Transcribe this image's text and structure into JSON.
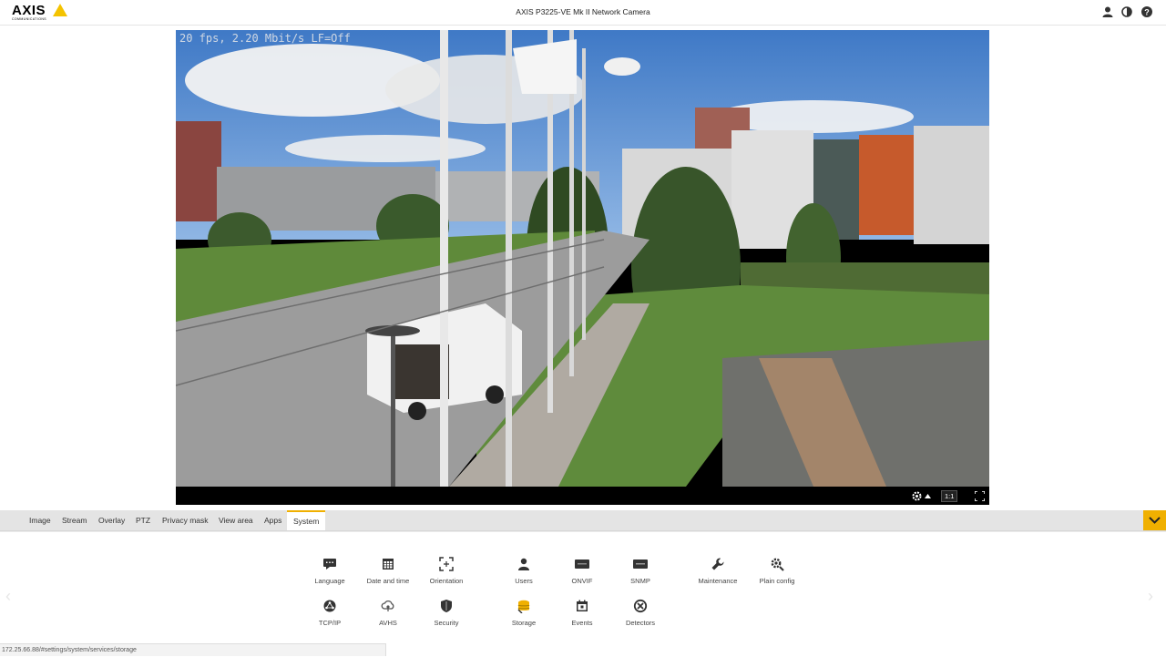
{
  "header": {
    "logo_text": "AXIS",
    "logo_sub": "COMMUNICATIONS",
    "title": "AXIS P3225-VE Mk II Network Camera",
    "icons": [
      "user-icon",
      "contrast-icon",
      "help-icon"
    ]
  },
  "video": {
    "overlay": "20 fps, 2.20 Mbit/s LF=Off",
    "ratio_label": "1:1"
  },
  "tabs": [
    {
      "label": "Image"
    },
    {
      "label": "Stream"
    },
    {
      "label": "Overlay"
    },
    {
      "label": "PTZ"
    },
    {
      "label": "Privacy mask"
    },
    {
      "label": "View area"
    },
    {
      "label": "Apps"
    },
    {
      "label": "System",
      "active": true
    }
  ],
  "settings": {
    "row1": [
      {
        "label": "Language",
        "icon": "language-icon"
      },
      {
        "label": "Date and time",
        "icon": "calendar-icon"
      },
      {
        "label": "Orientation",
        "icon": "orientation-icon"
      },
      {
        "label": "Users",
        "icon": "users-icon"
      },
      {
        "label": "ONVIF",
        "icon": "onvif-icon"
      },
      {
        "label": "SNMP",
        "icon": "snmp-icon"
      },
      {
        "label": "Maintenance",
        "icon": "wrench-icon"
      },
      {
        "label": "Plain config",
        "icon": "gear-icon"
      }
    ],
    "row2": [
      {
        "label": "TCP/IP",
        "icon": "network-icon"
      },
      {
        "label": "AVHS",
        "icon": "cloud-icon"
      },
      {
        "label": "Security",
        "icon": "shield-icon"
      },
      {
        "label": "Storage",
        "icon": "storage-icon"
      },
      {
        "label": "Events",
        "icon": "events-icon"
      },
      {
        "label": "Detectors",
        "icon": "detectors-icon"
      }
    ]
  },
  "status_url": "172.25.66.88/#settings/system/services/storage",
  "colors": {
    "accent": "#f0b000",
    "tab_bar": "#e4e4e4"
  }
}
